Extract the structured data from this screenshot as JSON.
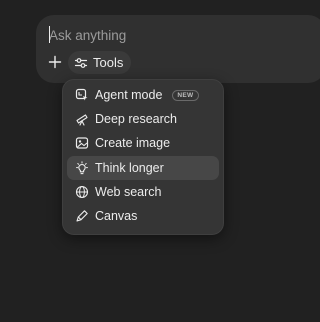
{
  "composer": {
    "placeholder": "Ask anything",
    "tools_label": "Tools"
  },
  "tools_menu": {
    "items": [
      {
        "label": "Agent mode",
        "icon": "agent-icon",
        "badge": "NEW"
      },
      {
        "label": "Deep research",
        "icon": "telescope-icon"
      },
      {
        "label": "Create image",
        "icon": "image-icon"
      },
      {
        "label": "Think longer",
        "icon": "lightbulb-icon",
        "highlighted": true
      },
      {
        "label": "Web search",
        "icon": "globe-icon"
      },
      {
        "label": "Canvas",
        "icon": "canvas-pen-icon"
      }
    ]
  },
  "colors": {
    "background": "#212121",
    "composer": "#303030",
    "menu": "#353535",
    "highlight": "#474747",
    "text": "#ececec"
  }
}
